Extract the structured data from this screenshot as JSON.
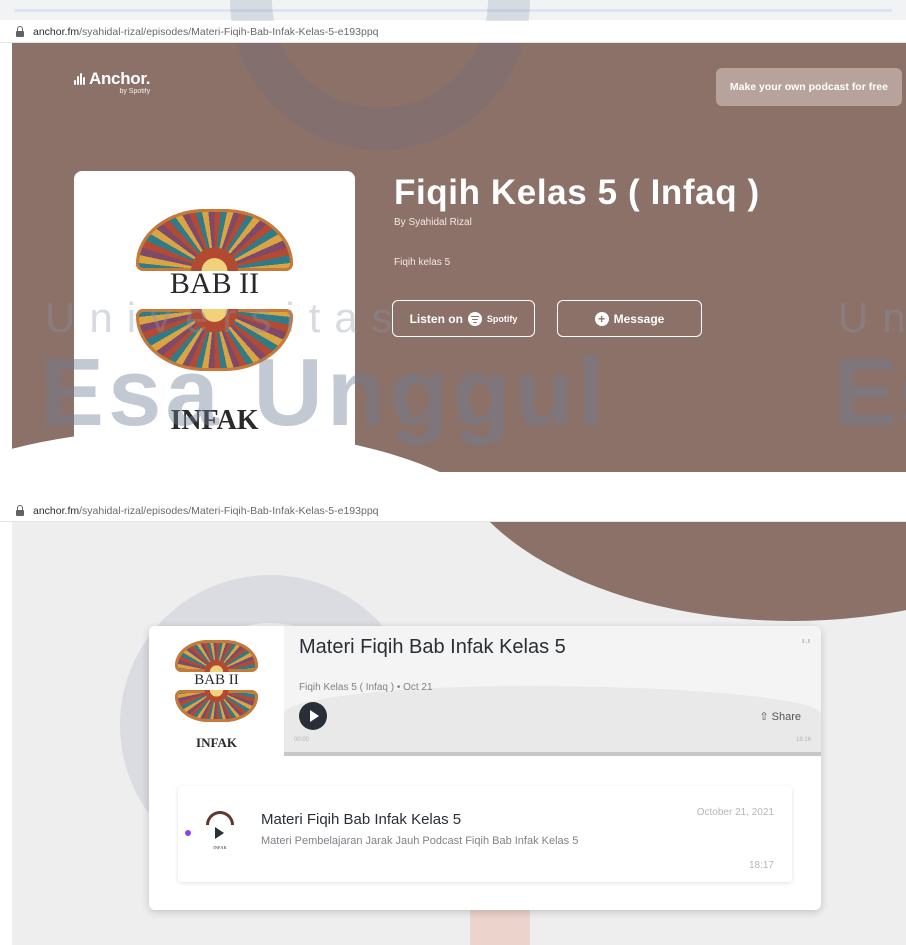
{
  "browser": {
    "url_host": "anchor.fm",
    "url_path": "/syahidal-rizal/episodes/Materi-Fiqih-Bab-Infak-Kelas-5-e193ppq"
  },
  "header": {
    "logo_text": "Anchor.",
    "logo_sub": "by Spotify",
    "cta": "Make your own podcast for free"
  },
  "podcast": {
    "title": "Fiqih Kelas 5 ( Infaq )",
    "author": "By Syahidal Rizal",
    "description": "Fiqih kelas 5",
    "cover_line1": "BAB II",
    "cover_line2": "INFAK",
    "listen_prefix": "Listen on",
    "listen_brand": "Spotify",
    "message_label": "Message"
  },
  "watermark": {
    "line1": "Universitas",
    "line2": "Esa Unggul",
    "line1_right": "Un",
    "line2_right": "Es"
  },
  "player": {
    "episode_title": "Materi Fiqih Bab Infak Kelas 5",
    "meta": "Fiqih Kelas 5 ( Infaq ) • Oct 21",
    "share_label": "Share",
    "time_current": "00:00",
    "time_total": "18:16",
    "progress_fraction": 0.0,
    "cover_line1": "BAB II",
    "cover_line2": "INFAK",
    "stats_icon": "bars-icon"
  },
  "episodes": [
    {
      "title": "Materi Fiqih Bab Infak Kelas 5",
      "description": "Materi Pembelajaran Jarak Jauh Podcast Fiqih Bab Infak Kelas 5",
      "date": "October 21, 2021",
      "duration": "18:17",
      "thumb_label": "INFAK"
    }
  ],
  "colors": {
    "brand_brown": "#8b7168",
    "spotify_dot": "#8940fa",
    "text_dark": "#292f36",
    "text_muted": "#7f8287"
  }
}
